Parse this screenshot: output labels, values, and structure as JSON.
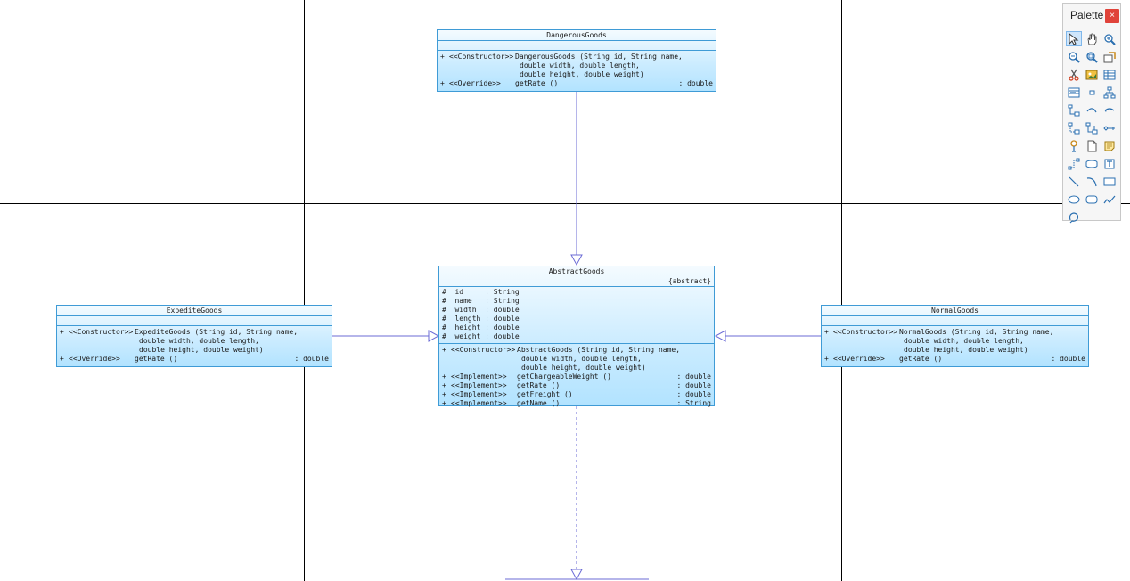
{
  "palette": {
    "title": "Palette",
    "close_label": "×",
    "tools": [
      {
        "name": "select-tool-icon",
        "icon": "arrow"
      },
      {
        "name": "pan-tool-icon",
        "icon": "hand"
      },
      {
        "name": "zoom-in-icon",
        "icon": "zoom-in"
      },
      {
        "name": "zoom-out-icon",
        "icon": "zoom-out"
      },
      {
        "name": "zoom-fit-icon",
        "icon": "zoom-fit"
      },
      {
        "name": "properties-icon",
        "icon": "props"
      },
      {
        "name": "cut-icon",
        "icon": "scissors"
      },
      {
        "name": "image-icon",
        "icon": "image"
      },
      {
        "name": "table-icon",
        "icon": "table"
      },
      {
        "name": "class-icon",
        "icon": "class"
      },
      {
        "name": "small-box-icon",
        "icon": "box"
      },
      {
        "name": "hierarchy-icon",
        "icon": "tree"
      },
      {
        "name": "generalization-icon",
        "icon": "gen"
      },
      {
        "name": "association-icon",
        "icon": "assoc"
      },
      {
        "name": "dependency-icon",
        "icon": "dep"
      },
      {
        "name": "realization-icon",
        "icon": "real"
      },
      {
        "name": "composition-icon",
        "icon": "comp"
      },
      {
        "name": "aggregation-icon",
        "icon": "agg"
      },
      {
        "name": "interface-icon",
        "icon": "lollipop"
      },
      {
        "name": "document-icon",
        "icon": "doc"
      },
      {
        "name": "note-icon",
        "icon": "note"
      },
      {
        "name": "connector-icon",
        "icon": "connector"
      },
      {
        "name": "cylinder-icon",
        "icon": "cyl"
      },
      {
        "name": "text-icon",
        "icon": "text"
      },
      {
        "name": "line-icon",
        "icon": "line"
      },
      {
        "name": "arc-icon",
        "icon": "arc"
      },
      {
        "name": "rectangle-icon",
        "icon": "rect"
      },
      {
        "name": "ellipse-icon",
        "icon": "ellipse"
      },
      {
        "name": "rounded-rect-icon",
        "icon": "rrect"
      },
      {
        "name": "freehand-icon",
        "icon": "free"
      },
      {
        "name": "lasso-icon",
        "icon": "lasso"
      }
    ]
  },
  "classes": {
    "dangerous": {
      "name": "DangerousGoods",
      "ops": [
        {
          "vis": "+",
          "stereo": "<<Constructor>>",
          "sig": [
            "DangerousGoods (String id, String name,",
            "double width, double length,",
            "double height, double weight)"
          ],
          "ret": ""
        },
        {
          "vis": "+",
          "stereo": "<<Override>>",
          "sig": [
            "getRate ()"
          ],
          "ret": ": double"
        }
      ]
    },
    "abstract": {
      "name": "AbstractGoods",
      "stereotype": "{abstract}",
      "attrs": [
        "#  id     : String",
        "#  name   : String",
        "#  width  : double",
        "#  length : double",
        "#  height : double",
        "#  weight : double"
      ],
      "ops": [
        {
          "vis": "+",
          "stereo": "<<Constructor>>",
          "sig": [
            "AbstractGoods (String id, String name,",
            "double width, double length,",
            "double height, double weight)"
          ],
          "ret": ""
        },
        {
          "vis": "+",
          "stereo": "<<Implement>>",
          "sig": [
            "getChargeableWeight ()"
          ],
          "ret": ": double"
        },
        {
          "vis": "+",
          "stereo": "<<Implement>>",
          "sig": [
            "getRate ()"
          ],
          "ret": ": double"
        },
        {
          "vis": "+",
          "stereo": "<<Implement>>",
          "sig": [
            "getFreight ()"
          ],
          "ret": ": double"
        },
        {
          "vis": "+",
          "stereo": "<<Implement>>",
          "sig": [
            "getName ()"
          ],
          "ret": ": String"
        }
      ]
    },
    "expedite": {
      "name": "ExpediteGoods",
      "ops": [
        {
          "vis": "+",
          "stereo": "<<Constructor>>",
          "sig": [
            "ExpediteGoods (String id, String name,",
            "double width, double length,",
            "double height, double weight)"
          ],
          "ret": ""
        },
        {
          "vis": "+",
          "stereo": "<<Override>>",
          "sig": [
            "getRate ()"
          ],
          "ret": ": double"
        }
      ]
    },
    "normal": {
      "name": "NormalGoods",
      "ops": [
        {
          "vis": "+",
          "stereo": "<<Constructor>>",
          "sig": [
            "NormalGoods (String id, String name,",
            "double width, double length,",
            "double height, double weight)"
          ],
          "ret": ""
        },
        {
          "vis": "+",
          "stereo": "<<Override>>",
          "sig": [
            "getRate ()"
          ],
          "ret": ": double"
        }
      ]
    }
  },
  "colors": {
    "connector": "#6b6bd6",
    "class_border": "#3f9bd6",
    "grid": "#000000"
  }
}
